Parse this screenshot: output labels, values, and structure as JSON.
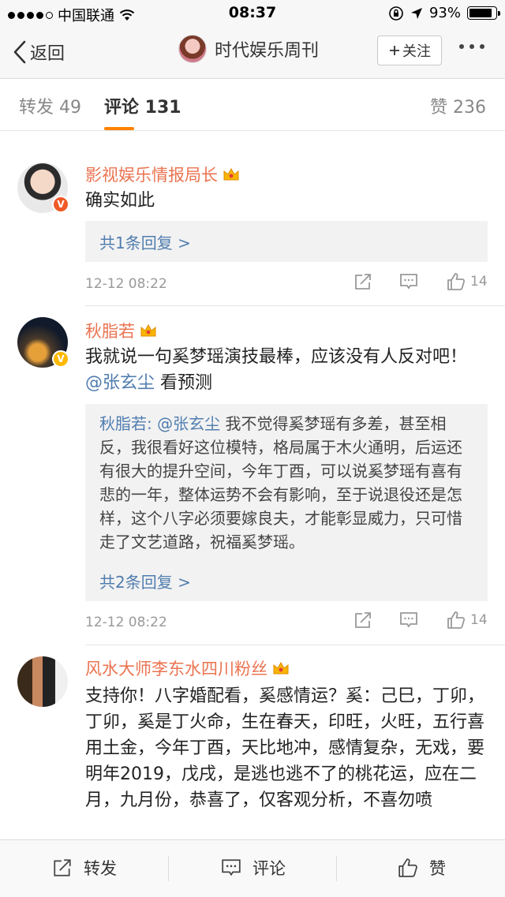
{
  "status_bar": {
    "carrier": "中国联通",
    "time": "08:37",
    "battery": "93%"
  },
  "nav": {
    "back_label": "返回",
    "title": "时代娱乐周刊",
    "follow_label": "关注"
  },
  "tabs": {
    "repost": "转发 49",
    "comments": "评论 131",
    "likes": "赞 236"
  },
  "comments": [
    {
      "user": "影视娱乐情报局长",
      "text": "确实如此",
      "reply_link": "共1条回复 >",
      "time": "12-12 08:22",
      "likes": "14"
    },
    {
      "user": "秋脂若",
      "text": "我就说一句奚梦瑶演技最棒，应该没有人反对吧！",
      "mention": "@张玄尘",
      "text_after_mention": " 看预测",
      "reply_author": "秋脂若:",
      "reply_mention": " @张玄尘",
      "reply_text": " 我不觉得奚梦瑶有多差，甚至相反，我很看好这位模特，格局属于木火通明，后运还有很大的提升空间，今年丁酉，可以说奚梦瑶有喜有悲的一年，整体运势不会有影响，至于说退役还是怎样，这个八字必须要嫁良夫，才能彰显威力，只可惜走了文艺道路，祝福奚梦瑶。",
      "reply_link": "共2条回复 >",
      "time": "12-12 08:22",
      "likes": "14"
    },
    {
      "user": "风水大师李东水四川粉丝",
      "text": "支持你！八字婚配看，奚感情运？奚：己巳，丁卯，丁卯，奚是丁火命，生在春天，印旺，火旺，五行喜用土金，今年丁酉，天比地冲，感情复杂，无戏，要明年2019，戊戌，是逃也逃不了的桃花运，应在二月，九月份，恭喜了，仅客观分析，不喜勿喷"
    }
  ],
  "bottom_bar": {
    "repost": "转发",
    "comment": "评论",
    "like": "赞"
  },
  "colors": {
    "accent": "#ff8200",
    "username": "#eb7350",
    "link": "#507daf"
  }
}
